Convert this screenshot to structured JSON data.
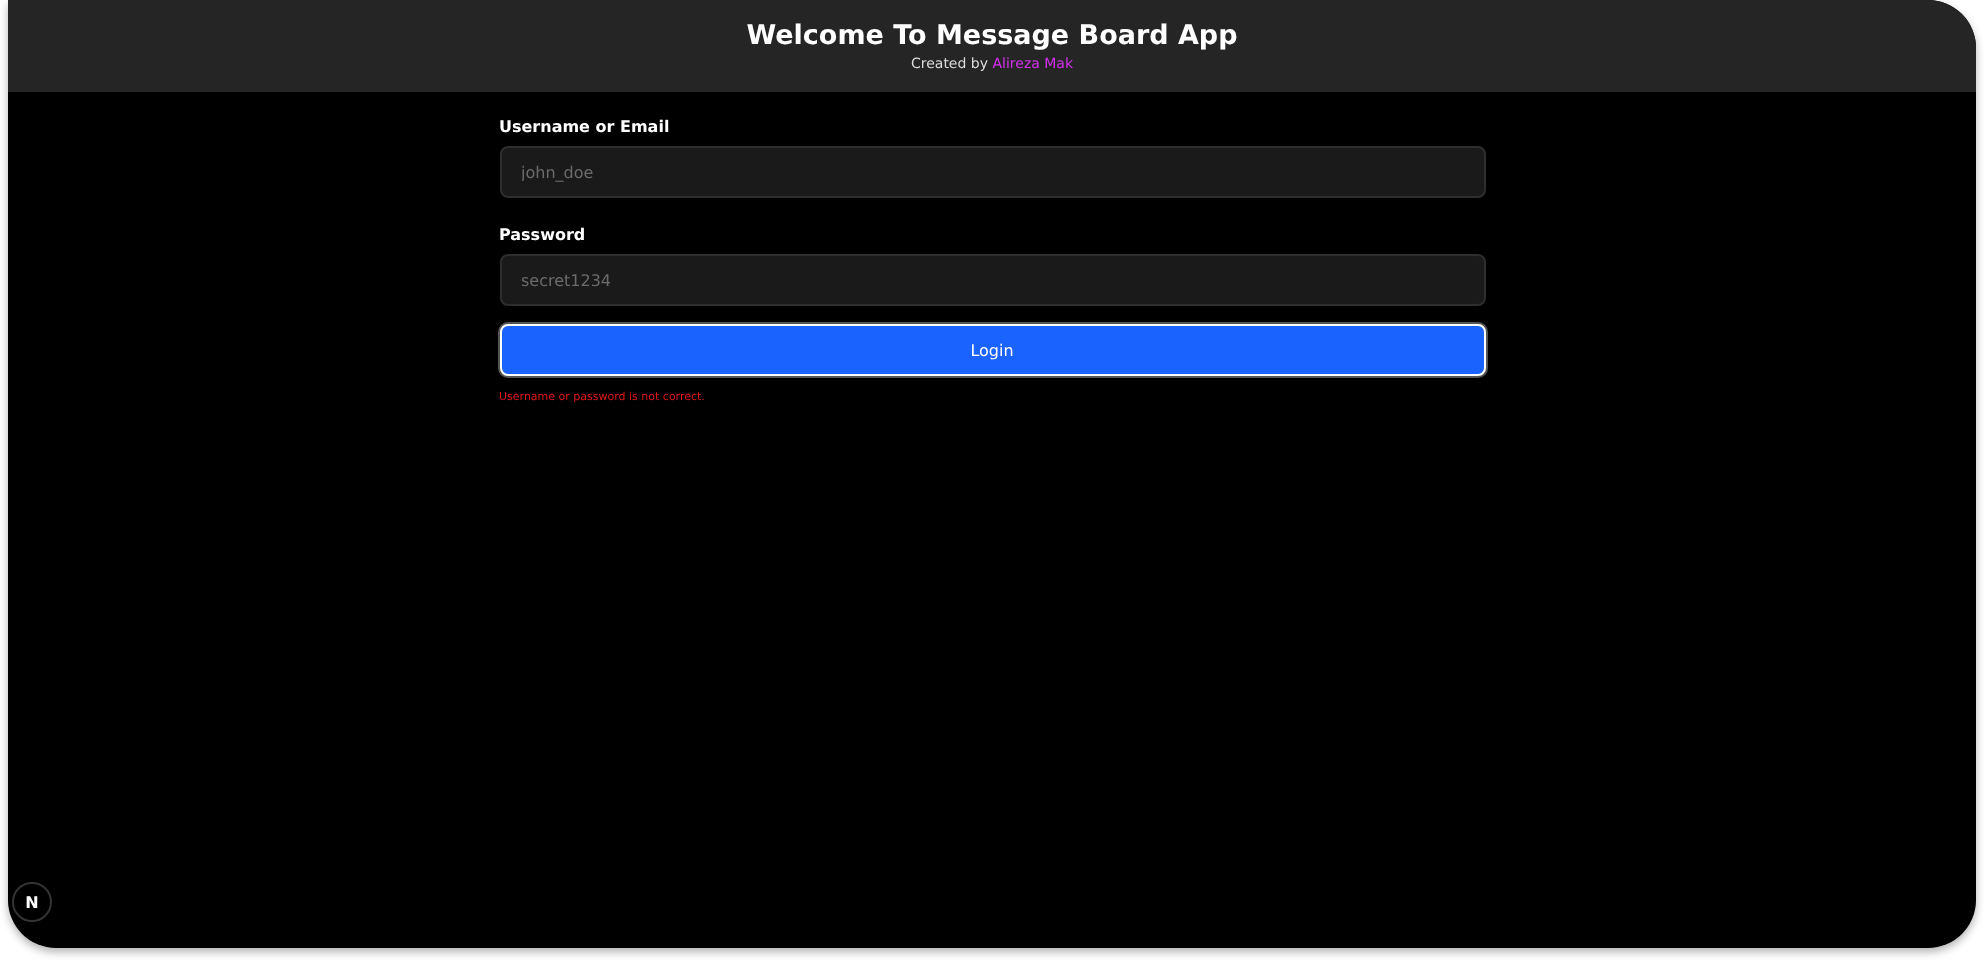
{
  "header": {
    "title": "Welcome To Message Board App",
    "credit_prefix": "Created by",
    "credit_author": "Alireza Mak"
  },
  "form": {
    "fields": [
      {
        "label": "Username or Email",
        "placeholder": "john_doe"
      },
      {
        "label": "Password",
        "placeholder": "secret1234"
      }
    ],
    "submit": {
      "label": "Login",
      "focused": true
    },
    "error": "Username or password is not correct."
  },
  "dev_badge": {
    "label": "N"
  }
}
